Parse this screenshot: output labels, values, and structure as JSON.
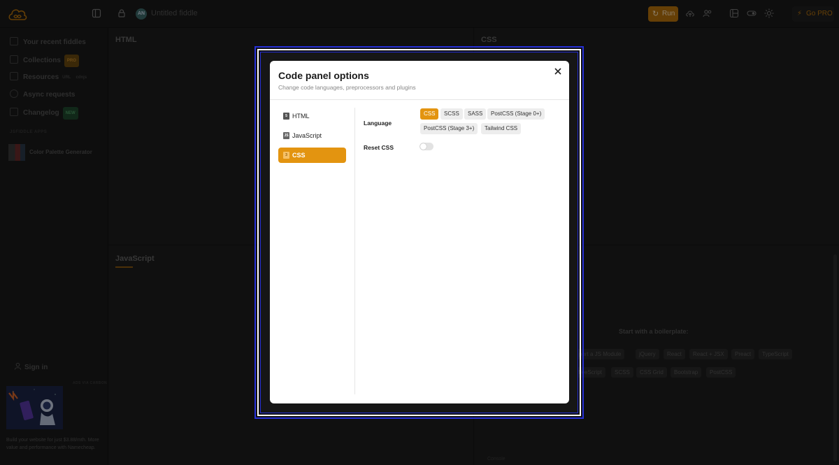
{
  "topbar": {
    "fiddle_title": "Untitled fiddle",
    "avatar_initials": "AN",
    "run_label": "Run",
    "gopro_label": "Go PRO"
  },
  "sidebar": {
    "items": [
      {
        "label": "Your recent fiddles",
        "icon": "grid-icon"
      },
      {
        "label": "Collections",
        "icon": "collection-icon",
        "badge": "PRO"
      },
      {
        "label": "Resources",
        "icon": "resources-icon",
        "extra1": "URL",
        "extra2": "cdnjs"
      },
      {
        "label": "Async requests",
        "icon": "async-icon"
      },
      {
        "label": "Changelog",
        "icon": "changelog-icon",
        "badge": "NEW"
      }
    ],
    "apps_section": "JSFIDDLE APPS",
    "app_item": "Color Palette Generator",
    "signin": "Sign in",
    "ads_label": "ADS VIA CARBON",
    "ad_text": "Build your website for just $3.88/mth. More value and performance with Namecheap."
  },
  "panels": {
    "html": "HTML",
    "css": "CSS",
    "javascript": "JavaScript",
    "boilerplate_title": "Start with a boilerplate:",
    "boilerplate_row1": [
      "port a JS Module",
      "jQuery",
      "React",
      "React + JSX",
      "Preact",
      "TypeScript"
    ],
    "boilerplate_row2": [
      "CoffeeScript",
      "SCSS",
      "CSS Grid",
      "Bootstrap",
      "PostCSS"
    ],
    "console": "Console"
  },
  "modal": {
    "title": "Code panel options",
    "subtitle": "Change code languages, preprocessors and plugins",
    "nav": [
      {
        "label": "HTML",
        "icon_text": "5"
      },
      {
        "label": "JavaScript",
        "icon_text": "JS"
      },
      {
        "label": "CSS",
        "icon_text": "3"
      }
    ],
    "language_label": "Language",
    "languages": [
      "CSS",
      "SCSS",
      "SASS",
      "PostCSS (Stage 0+)",
      "PostCSS (Stage 3+)",
      "Tailwind CSS"
    ],
    "reset_label": "Reset CSS"
  },
  "colors": {
    "accent": "#e39410",
    "focus_ring": "#2630d6"
  }
}
